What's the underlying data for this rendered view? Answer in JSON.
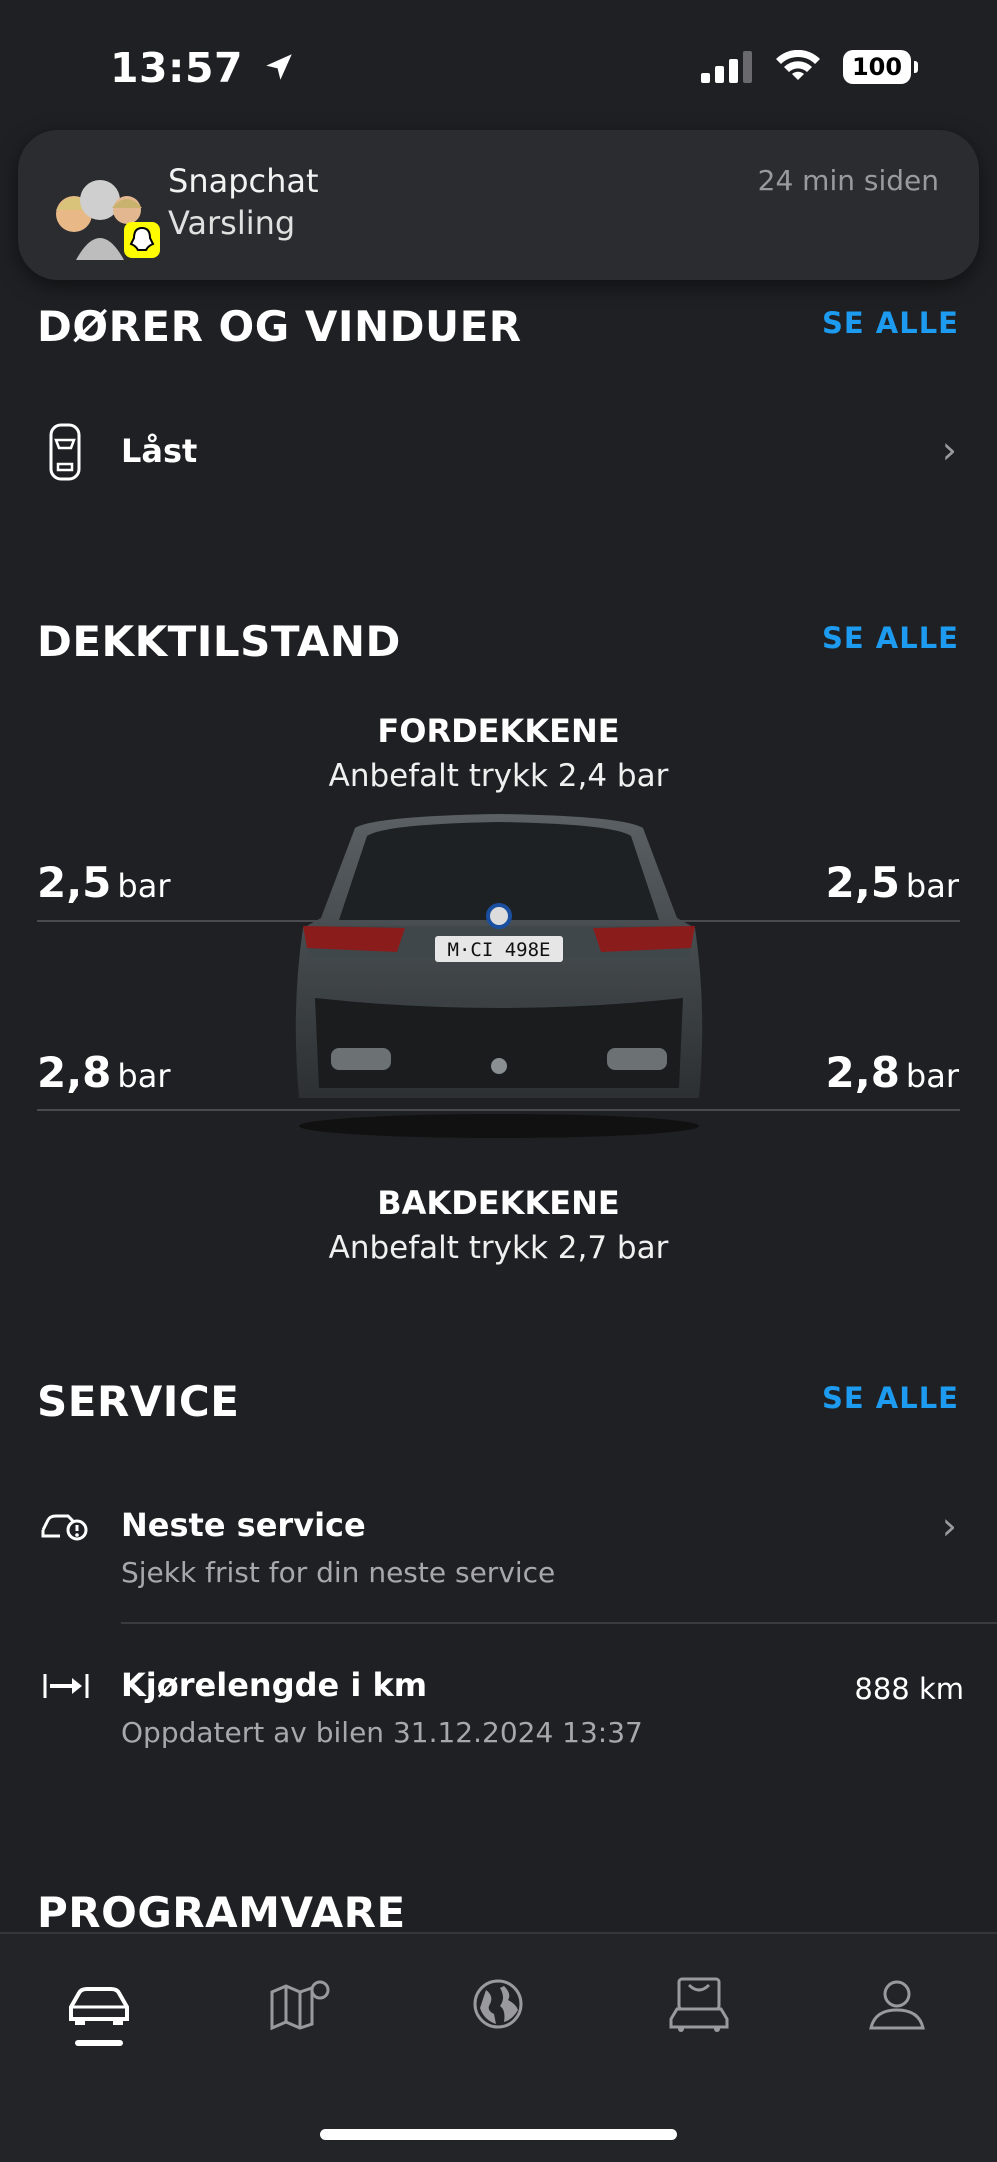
{
  "status_bar": {
    "time": "13:57",
    "battery": "100"
  },
  "notification": {
    "app": "Snapchat",
    "body": "Varsling",
    "time": "24 min siden"
  },
  "doors": {
    "title": "DØRER OG VINDUER",
    "see_all": "SE ALLE",
    "status": "Låst"
  },
  "tires": {
    "title": "DEKKTILSTAND",
    "see_all": "SE ALLE",
    "front_label": "FORDEKKENE",
    "front_recommended": "Anbefalt trykk 2,4 bar",
    "rear_label": "BAKDEKKENE",
    "rear_recommended": "Anbefalt trykk 2,7 bar",
    "unit": "bar",
    "front_left": "2,5",
    "front_right": "2,5",
    "rear_left": "2,8",
    "rear_right": "2,8",
    "license_plate": "M·CI 498E"
  },
  "service": {
    "title": "SERVICE",
    "see_all": "SE ALLE",
    "next_service_title": "Neste service",
    "next_service_sub": "Sjekk frist for din neste service",
    "mileage_title": "Kjørelengde i km",
    "mileage_sub": "Oppdatert av bilen 31.12.2024 13:37",
    "mileage_value": "888 km"
  },
  "software": {
    "title": "PROGRAMVARE"
  },
  "nav": {
    "items": [
      "car-icon",
      "map-icon",
      "globe-icon",
      "shop-icon",
      "profile-icon"
    ],
    "active": "car-icon"
  },
  "colors": {
    "background": "#1f2023",
    "accent": "#1d9bf0",
    "snapchat": "#fffc00"
  }
}
